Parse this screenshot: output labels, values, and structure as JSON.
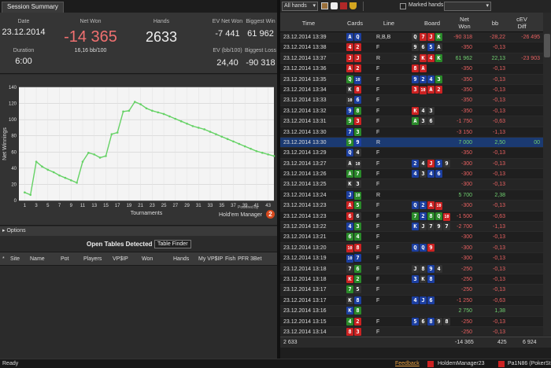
{
  "session": {
    "tab": "Session Summary",
    "date_label": "Date",
    "date": "23.12.2014",
    "duration_label": "Duration",
    "duration": "6:00",
    "netwon_label": "Net Won",
    "netwon": "-14 365",
    "netwon_sub": "16,16 bb/100",
    "hands_label": "Hands",
    "hands": "2633",
    "ev_label": "EV Net Won",
    "ev": "-7 441",
    "bigwin_label": "Biggest Win",
    "bigwin": "61 962",
    "evbb_label": "EV (bb/100)",
    "evbb": "24,40",
    "bigloss_label": "Biggest Loss",
    "bigloss": "-90 318"
  },
  "chart_data": {
    "type": "line",
    "title": "",
    "xlabel": "Tournaments",
    "ylabel": "Net Winnings",
    "ylim": [
      0,
      140
    ],
    "yticks": [
      0,
      20,
      40,
      60,
      80,
      100,
      120,
      140
    ],
    "xticks": [
      1,
      3,
      5,
      7,
      9,
      11,
      13,
      15,
      17,
      19,
      21,
      23,
      25,
      27,
      29,
      31,
      33,
      35,
      37,
      39,
      41,
      43
    ],
    "xlim": [
      0,
      44
    ],
    "x": [
      1,
      2,
      3,
      4,
      5,
      6,
      7,
      8,
      9,
      10,
      11,
      12,
      13,
      14,
      15,
      16,
      17,
      18,
      19,
      20,
      21,
      22,
      23,
      24,
      25,
      26,
      27,
      28,
      29,
      30,
      31,
      32,
      33,
      34,
      35,
      36,
      37,
      38,
      39,
      40,
      41,
      42,
      43,
      44
    ],
    "values": [
      10,
      7,
      48,
      42,
      38,
      35,
      31,
      28,
      25,
      22,
      48,
      59,
      57,
      53,
      55,
      82,
      84,
      110,
      111,
      122,
      119,
      114,
      111,
      109,
      107,
      104,
      101,
      98,
      95,
      92,
      90,
      88,
      85,
      82,
      79,
      76,
      73,
      70,
      67,
      64,
      61,
      59,
      57,
      55
    ],
    "color": "#66d266",
    "grid": true
  },
  "powered": {
    "line1": "Powered by",
    "line2": "Hold'em Manager",
    "badge": "2"
  },
  "options_label": "Options",
  "open_tables": {
    "title": "Open Tables Detected",
    "finder_button": "Table Finder",
    "columns": [
      "*",
      "Site",
      "Name",
      "Pot",
      "Players",
      "VP$IP",
      "Won",
      "Hands",
      "My VP$IP",
      "Fish",
      "PFR",
      "3Bet"
    ]
  },
  "toolbar": {
    "filter": "All hands",
    "marked": "Marked hands"
  },
  "hands_table": {
    "columns": [
      "Time",
      "Cards",
      "Line",
      "Board",
      "Net Won",
      "bb",
      "cEV Diff"
    ],
    "rows": [
      {
        "time": "23.12.2014 13:39",
        "cards": [
          [
            "A",
            "#1c3fa0"
          ],
          [
            "Q",
            "#1c3fa0"
          ]
        ],
        "line": "R,B,B",
        "board": [
          [
            "Q",
            "#333"
          ],
          [
            "7",
            "#c22"
          ],
          [
            "J",
            "#c22"
          ],
          [
            "K",
            "#2a8a2a"
          ]
        ],
        "net": "-90 318",
        "bb": "-28,22",
        "cev": "-26 495"
      },
      {
        "time": "23.12.2014 13:38",
        "cards": [
          [
            "4",
            "#c22"
          ],
          [
            "2",
            "#c22"
          ]
        ],
        "line": "F",
        "board": [
          [
            "9",
            "#333"
          ],
          [
            "6",
            "#333"
          ],
          [
            "5",
            "#1c3fa0"
          ],
          [
            "A",
            "#333"
          ]
        ],
        "net": "-350",
        "bb": "-0,13",
        "cev": ""
      },
      {
        "time": "23.12.2014 13:37",
        "cards": [
          [
            "J",
            "#c22"
          ],
          [
            "J",
            "#c22"
          ]
        ],
        "line": "R",
        "board": [
          [
            "2",
            "#333"
          ],
          [
            "K",
            "#c22"
          ],
          [
            "4",
            "#c22"
          ],
          [
            "K",
            "#2a8a2a"
          ]
        ],
        "net": "61 962",
        "bb": "22,13",
        "cev": "-23 903"
      },
      {
        "time": "23.12.2014 13:36",
        "cards": [
          [
            "A",
            "#c22"
          ],
          [
            "2",
            "#c22"
          ]
        ],
        "line": "F",
        "board": [
          [
            "8",
            "#c22"
          ],
          [
            "A",
            "#c22"
          ]
        ],
        "net": "-350",
        "bb": "-0,13",
        "cev": ""
      },
      {
        "time": "23.12.2014 13:35",
        "cards": [
          [
            "Q",
            "#2a8a2a"
          ],
          [
            "10",
            "#1c3fa0"
          ]
        ],
        "line": "F",
        "board": [
          [
            "9",
            "#1c3fa0"
          ],
          [
            "2",
            "#1c3fa0"
          ],
          [
            "4",
            "#1c3fa0"
          ],
          [
            "3",
            "#2a8a2a"
          ]
        ],
        "net": "-350",
        "bb": "-0,13",
        "cev": ""
      },
      {
        "time": "23.12.2014 13:34",
        "cards": [
          [
            "K",
            "#333"
          ],
          [
            "8",
            "#c22"
          ]
        ],
        "line": "F",
        "board": [
          [
            "3",
            "#c22"
          ],
          [
            "10",
            "#c22"
          ],
          [
            "A",
            "#c22"
          ],
          [
            "2",
            "#c22"
          ]
        ],
        "net": "-350",
        "bb": "-0,13",
        "cev": ""
      },
      {
        "time": "23.12.2014 13:33",
        "cards": [
          [
            "10",
            "#333"
          ],
          [
            "6",
            "#1c3fa0"
          ]
        ],
        "line": "F",
        "board": [],
        "net": "-350",
        "bb": "-0,13",
        "cev": ""
      },
      {
        "time": "23.12.2014 13:32",
        "cards": [
          [
            "9",
            "#1c3fa0"
          ],
          [
            "8",
            "#2a8a2a"
          ]
        ],
        "line": "F",
        "board": [
          [
            "K",
            "#c22"
          ],
          [
            "4",
            "#333"
          ],
          [
            "3",
            "#333"
          ]
        ],
        "net": "-350",
        "bb": "-0,13",
        "cev": ""
      },
      {
        "time": "23.12.2014 13:31",
        "cards": [
          [
            "9",
            "#2a8a2a"
          ],
          [
            "3",
            "#c22"
          ]
        ],
        "line": "F",
        "board": [
          [
            "A",
            "#2a8a2a"
          ],
          [
            "3",
            "#333"
          ],
          [
            "6",
            "#333"
          ]
        ],
        "net": "-1 750",
        "bb": "-0,63",
        "cev": ""
      },
      {
        "time": "23.12.2014 13:30",
        "cards": [
          [
            "7",
            "#1c3fa0"
          ],
          [
            "3",
            "#2a8a2a"
          ]
        ],
        "line": "F",
        "board": [],
        "net": "-3 150",
        "bb": "-1,13",
        "cev": ""
      },
      {
        "time": "23.12.2014 13:30",
        "cards": [
          [
            "9",
            "#2a8a2a"
          ],
          [
            "9",
            "#1c3fa0"
          ]
        ],
        "line": "R",
        "board": [],
        "net": "7 000",
        "bb": "2,50",
        "cev": "00",
        "sel": true
      },
      {
        "time": "23.12.2014 13:29",
        "cards": [
          [
            "Q",
            "#1c3fa0"
          ],
          [
            "4",
            "#333"
          ]
        ],
        "line": "F",
        "board": [],
        "net": "-350",
        "bb": "-0,13",
        "cev": ""
      },
      {
        "time": "23.12.2014 13:27",
        "cards": [
          [
            "A",
            "#333"
          ],
          [
            "10",
            "#333"
          ]
        ],
        "line": "F",
        "board": [
          [
            "2",
            "#1c3fa0"
          ],
          [
            "4",
            "#333"
          ],
          [
            "J",
            "#c22"
          ],
          [
            "5",
            "#1c3fa0"
          ],
          [
            "9",
            "#333"
          ]
        ],
        "net": "-300",
        "bb": "-0,13",
        "cev": ""
      },
      {
        "time": "23.12.2014 13:26",
        "cards": [
          [
            "A",
            "#2a8a2a"
          ],
          [
            "7",
            "#2a8a2a"
          ]
        ],
        "line": "F",
        "board": [
          [
            "4",
            "#1c3fa0"
          ],
          [
            "3",
            "#333"
          ],
          [
            "4",
            "#1c3fa0"
          ],
          [
            "6",
            "#1c3fa0"
          ]
        ],
        "net": "-300",
        "bb": "-0,13",
        "cev": ""
      },
      {
        "time": "23.12.2014 13:25",
        "cards": [
          [
            "K",
            "#333"
          ],
          [
            "3",
            "#333"
          ]
        ],
        "line": "F",
        "board": [],
        "net": "-300",
        "bb": "-0,13",
        "cev": ""
      },
      {
        "time": "23.12.2014 13:24",
        "cards": [
          [
            "J",
            "#1c3fa0"
          ],
          [
            "10",
            "#2a8a2a"
          ]
        ],
        "line": "R",
        "board": [],
        "net": "5 700",
        "bb": "2,38",
        "cev": ""
      },
      {
        "time": "23.12.2014 13:23",
        "cards": [
          [
            "A",
            "#c22"
          ],
          [
            "5",
            "#2a8a2a"
          ]
        ],
        "line": "F",
        "board": [
          [
            "Q",
            "#1c3fa0"
          ],
          [
            "2",
            "#1c3fa0"
          ],
          [
            "A",
            "#c22"
          ],
          [
            "10",
            "#c22"
          ]
        ],
        "net": "-300",
        "bb": "-0,13",
        "cev": ""
      },
      {
        "time": "23.12.2014 13:23",
        "cards": [
          [
            "6",
            "#c22"
          ],
          [
            "6",
            "#333"
          ]
        ],
        "line": "F",
        "board": [
          [
            "7",
            "#2a8a2a"
          ],
          [
            "2",
            "#1c3fa0"
          ],
          [
            "8",
            "#2a8a2a"
          ],
          [
            "Q",
            "#2a8a2a"
          ],
          [
            "10",
            "#c22"
          ]
        ],
        "net": "-1 500",
        "bb": "-0,63",
        "cev": ""
      },
      {
        "time": "23.12.2014 13:22",
        "cards": [
          [
            "4",
            "#1c3fa0"
          ],
          [
            "3",
            "#2a8a2a"
          ]
        ],
        "line": "F",
        "board": [
          [
            "K",
            "#1c3fa0"
          ],
          [
            "J",
            "#333"
          ],
          [
            "7",
            "#333"
          ],
          [
            "9",
            "#333"
          ],
          [
            "7",
            "#333"
          ]
        ],
        "net": "-2 700",
        "bb": "-1,13",
        "cev": ""
      },
      {
        "time": "23.12.2014 13:21",
        "cards": [
          [
            "6",
            "#2a8a2a"
          ],
          [
            "4",
            "#2a8a2a"
          ]
        ],
        "line": "F",
        "board": [],
        "net": "-300",
        "bb": "-0,13",
        "cev": ""
      },
      {
        "time": "23.12.2014 13:20",
        "cards": [
          [
            "10",
            "#c22"
          ],
          [
            "8",
            "#c22"
          ]
        ],
        "line": "F",
        "board": [
          [
            "Q",
            "#1c3fa0"
          ],
          [
            "Q",
            "#1c3fa0"
          ],
          [
            "9",
            "#c22"
          ]
        ],
        "net": "-300",
        "bb": "-0,13",
        "cev": ""
      },
      {
        "time": "23.12.2014 13:19",
        "cards": [
          [
            "10",
            "#1c3fa0"
          ],
          [
            "7",
            "#1c3fa0"
          ]
        ],
        "line": "F",
        "board": [],
        "net": "-300",
        "bb": "-0,13",
        "cev": ""
      },
      {
        "time": "23.12.2014 13:18",
        "cards": [
          [
            "7",
            "#333"
          ],
          [
            "6",
            "#2a8a2a"
          ]
        ],
        "line": "F",
        "board": [
          [
            "J",
            "#333"
          ],
          [
            "8",
            "#333"
          ],
          [
            "9",
            "#1c3fa0"
          ],
          [
            "4",
            "#333"
          ]
        ],
        "net": "-250",
        "bb": "-0,13",
        "cev": ""
      },
      {
        "time": "23.12.2014 13:18",
        "cards": [
          [
            "K",
            "#c22"
          ],
          [
            "2",
            "#2a8a2a"
          ]
        ],
        "line": "F",
        "board": [
          [
            "3",
            "#1c3fa0"
          ],
          [
            "K",
            "#333"
          ],
          [
            "8",
            "#1c3fa0"
          ]
        ],
        "net": "-250",
        "bb": "-0,13",
        "cev": ""
      },
      {
        "time": "23.12.2014 13:17",
        "cards": [
          [
            "7",
            "#2a8a2a"
          ],
          [
            "5",
            "#333"
          ]
        ],
        "line": "F",
        "board": [],
        "net": "-250",
        "bb": "-0,13",
        "cev": ""
      },
      {
        "time": "23.12.2014 13:17",
        "cards": [
          [
            "K",
            "#333"
          ],
          [
            "8",
            "#1c3fa0"
          ]
        ],
        "line": "F",
        "board": [
          [
            "4",
            "#1c3fa0"
          ],
          [
            "J",
            "#1c3fa0"
          ],
          [
            "6",
            "#1c3fa0"
          ]
        ],
        "net": "-1 250",
        "bb": "-0,63",
        "cev": ""
      },
      {
        "time": "23.12.2014 13:16",
        "cards": [
          [
            "K",
            "#1c3fa0"
          ],
          [
            "8",
            "#2a8a2a"
          ]
        ],
        "line": "",
        "board": [],
        "net": "2 750",
        "bb": "1,38",
        "cev": ""
      },
      {
        "time": "23.12.2014 13:15",
        "cards": [
          [
            "4",
            "#2a8a2a"
          ],
          [
            "2",
            "#c22"
          ]
        ],
        "line": "F",
        "board": [
          [
            "5",
            "#1c3fa0"
          ],
          [
            "6",
            "#333"
          ],
          [
            "8",
            "#1c3fa0"
          ],
          [
            "9",
            "#333"
          ],
          [
            "8",
            "#333"
          ]
        ],
        "net": "-250",
        "bb": "-0,13",
        "cev": ""
      },
      {
        "time": "23.12.2014 13:14",
        "cards": [
          [
            "8",
            "#c22"
          ],
          [
            "3",
            "#c22"
          ]
        ],
        "line": "F",
        "board": [],
        "net": "-250",
        "bb": "-0,13",
        "cev": ""
      }
    ],
    "summary": {
      "count": "2 633",
      "net": "-14 365",
      "bb": "425",
      "cev": "6 924"
    }
  },
  "status": {
    "left": "Ready",
    "feedback": "Feedback",
    "app": "HoldemManager23",
    "user": "Pa1N86 (PokerSt"
  }
}
